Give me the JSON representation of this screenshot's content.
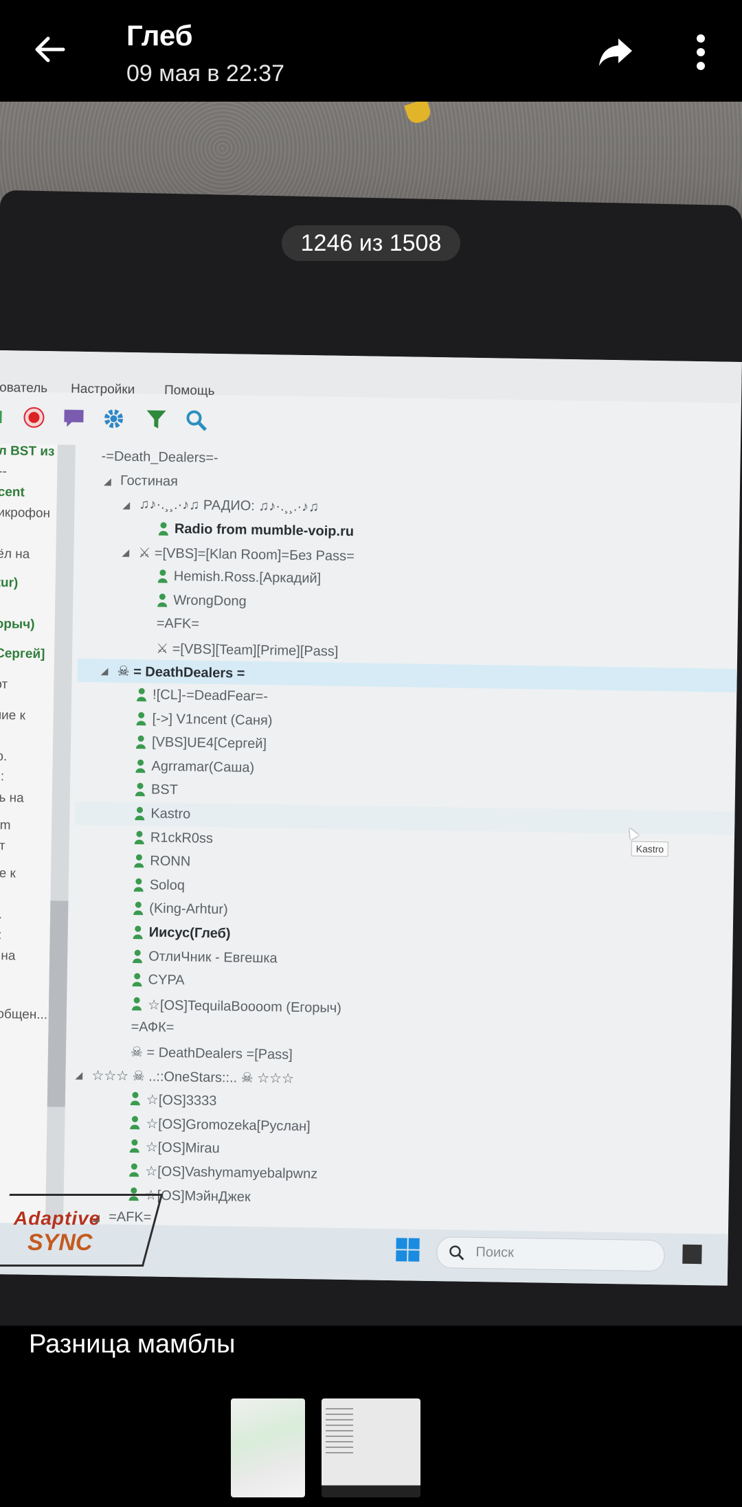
{
  "header": {
    "sender_name": "Глеб",
    "date": "09 мая в 22:37"
  },
  "photo_counter": "1246 из 1508",
  "mumble": {
    "menu": [
      "ователь",
      "Настройки",
      "Помощь"
    ],
    "left_panel": [
      {
        "text": "л BST из",
        "green": true
      },
      {
        "text": "--",
        "green": false
      },
      {
        "text": "cent",
        "green": true
      },
      {
        "text": "икрофон",
        "green": false
      },
      {
        "text": "ёл на",
        "green": false
      },
      {
        "text": "tur)",
        "green": true
      },
      {
        "text": "орыч)",
        "green": true
      },
      {
        "text": "Сергей]",
        "green": true
      },
      {
        "text": "от",
        "green": false
      },
      {
        "text": "ние к",
        "green": false
      },
      {
        "text": "ю.",
        "green": false
      },
      {
        "text": "е:",
        "green": false
      },
      {
        "text": "ть на",
        "green": false
      },
      {
        "text": "om",
        "green": false
      },
      {
        "text": "от",
        "green": false
      },
      {
        "text": "ие к",
        "green": false
      },
      {
        "text": "о.",
        "green": false
      },
      {
        "text": "е:",
        "green": false
      },
      {
        "text": "ь на",
        "green": false
      },
      {
        "text": "u",
        "green": false
      },
      {
        "text": "ообщен...",
        "green": false
      }
    ],
    "tree": [
      {
        "text": "-=Death_Dealers=-",
        "indent": 0,
        "type": "root"
      },
      {
        "text": "Гостиная",
        "indent": 1,
        "type": "channel",
        "arrow": true
      },
      {
        "text": "♫♪·.¸¸.·♪♫ РАДИО: ♫♪·.¸¸.·♪♫",
        "indent": 2,
        "type": "channel",
        "arrow": true
      },
      {
        "text": "Radio from mumble-voip.ru",
        "indent": 3,
        "type": "user",
        "bold": true
      },
      {
        "text": "⚔ =[VBS]=[Klan Room]=Без Pass=",
        "indent": 2,
        "type": "channel",
        "arrow": true
      },
      {
        "text": "Hemish.Ross.[Аркадий]",
        "indent": 3,
        "type": "user"
      },
      {
        "text": "WrongDong",
        "indent": 3,
        "type": "user"
      },
      {
        "text": "=AFK=",
        "indent": 3,
        "type": "channel"
      },
      {
        "text": "⚔ =[VBS][Team][Prime][Pass]",
        "indent": 3,
        "type": "channel"
      },
      {
        "text": "☠ = DeathDealers =",
        "indent": 1,
        "type": "channel",
        "arrow": true,
        "bold": true,
        "selected": true
      },
      {
        "text": "![CL]-=DeadFear=-",
        "indent": 2,
        "type": "user"
      },
      {
        "text": "[->] V1ncent (Саня)",
        "indent": 2,
        "type": "user"
      },
      {
        "text": "[VBS]UE4[Сергей]",
        "indent": 2,
        "type": "user"
      },
      {
        "text": "Agrramar(Саша)",
        "indent": 2,
        "type": "user"
      },
      {
        "text": "BST",
        "indent": 2,
        "type": "user"
      },
      {
        "text": "Kastro",
        "indent": 2,
        "type": "user",
        "hover": true
      },
      {
        "text": "R1ckR0ss",
        "indent": 2,
        "type": "user"
      },
      {
        "text": "RONN",
        "indent": 2,
        "type": "user"
      },
      {
        "text": "Soloq",
        "indent": 2,
        "type": "user"
      },
      {
        "text": "(King-Arhtur)",
        "indent": 2,
        "type": "user"
      },
      {
        "text": "Иисус(Глеб)",
        "indent": 2,
        "type": "user",
        "bold": true
      },
      {
        "text": "ОтлиЧник - Евгешка",
        "indent": 2,
        "type": "user"
      },
      {
        "text": "CYPA",
        "indent": 2,
        "type": "user"
      },
      {
        "text": "☆[OS]TequilaBoooom (Егорыч)",
        "indent": 2,
        "type": "user"
      },
      {
        "text": "=АФК=",
        "indent": 2,
        "type": "channel"
      },
      {
        "text": "☠ = DeathDealers =[Pass]",
        "indent": 2,
        "type": "channel"
      },
      {
        "text": "☆☆☆ ☠ ..::OneStars::.. ☠ ☆☆☆",
        "indent": 0,
        "type": "channel",
        "arrow": true
      },
      {
        "text": "☆[OS]3333",
        "indent": 2,
        "type": "user"
      },
      {
        "text": "☆[OS]Gromozeka[Руслан]",
        "indent": 2,
        "type": "user"
      },
      {
        "text": "☆[OS]Mirau",
        "indent": 2,
        "type": "user"
      },
      {
        "text": "☆[OS]Vashymamyebalpwnz",
        "indent": 2,
        "type": "user"
      },
      {
        "text": "☆[OS]МэйнДжек",
        "indent": 2,
        "type": "user"
      },
      {
        "text": "=AFK=",
        "indent": 1,
        "type": "channel",
        "arrow": true
      }
    ],
    "tooltip": "Kastro",
    "taskbar_search_placeholder": "Поиск"
  },
  "laptop_brand": {
    "line1": "Adaptive",
    "line2": "SYNC"
  },
  "caption": "Разница мамблы",
  "colors": {
    "user_icon": "#3a9a4f",
    "selected_row": "#d6ebf6",
    "background": "#000000"
  }
}
